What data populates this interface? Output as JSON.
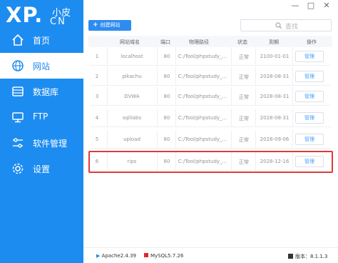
{
  "app": {
    "logo_main": "XP.",
    "logo_sub_top": "小皮",
    "logo_sub_bottom": "CN"
  },
  "window": {
    "controls": [
      "—",
      "□",
      "✕"
    ]
  },
  "sidebar": {
    "items": [
      {
        "label": "首页",
        "icon": "home-icon",
        "active": false
      },
      {
        "label": "网站",
        "icon": "globe-icon",
        "active": true
      },
      {
        "label": "数据库",
        "icon": "database-icon",
        "active": false
      },
      {
        "label": "FTP",
        "icon": "monitor-icon",
        "active": false
      },
      {
        "label": "软件管理",
        "icon": "sliders-icon",
        "active": false
      },
      {
        "label": "设置",
        "icon": "gear-icon",
        "active": false
      }
    ]
  },
  "toolbar": {
    "create_label": "创建网站",
    "search_placeholder": "查找"
  },
  "table": {
    "headers": [
      "网站域名",
      "端口",
      "物理路径",
      "状态",
      "到期",
      "操作"
    ],
    "rows": [
      {
        "id": "1",
        "domain": "localhost",
        "port": "80",
        "path": "C:/Tool/phpstudy_...",
        "status": "正常",
        "expiry": "2100-01-01",
        "action": "管理"
      },
      {
        "id": "2",
        "domain": "pikachu",
        "port": "80",
        "path": "C:/Tool/phpstudy_...",
        "status": "正常",
        "expiry": "2028-08-31",
        "action": "管理"
      },
      {
        "id": "3",
        "domain": "DVWA",
        "port": "80",
        "path": "C:/Tool/phpstudy_...",
        "status": "正常",
        "expiry": "2028-08-31",
        "action": "管理"
      },
      {
        "id": "4",
        "domain": "sqlilabs",
        "port": "80",
        "path": "C:/Tool/phpstudy_...",
        "status": "正常",
        "expiry": "2028-08-31",
        "action": "管理"
      },
      {
        "id": "5",
        "domain": "upload",
        "port": "80",
        "path": "C:/Tool/phpstudy_...",
        "status": "正常",
        "expiry": "2028-09-06",
        "action": "管理"
      },
      {
        "id": "6",
        "domain": "rips",
        "port": "80",
        "path": "C:/Tool/phpstudy_...",
        "status": "正常",
        "expiry": "2028-12-16",
        "action": "管理"
      }
    ]
  },
  "statusbar": {
    "apache": "Apache2.4.39",
    "mysql": "MySQL5.7.26",
    "version": "版本：8.1.1.3"
  },
  "colors": {
    "brand": "#1d8cf0",
    "highlight": "#e03a3a",
    "mysql_red": "#e02828"
  }
}
